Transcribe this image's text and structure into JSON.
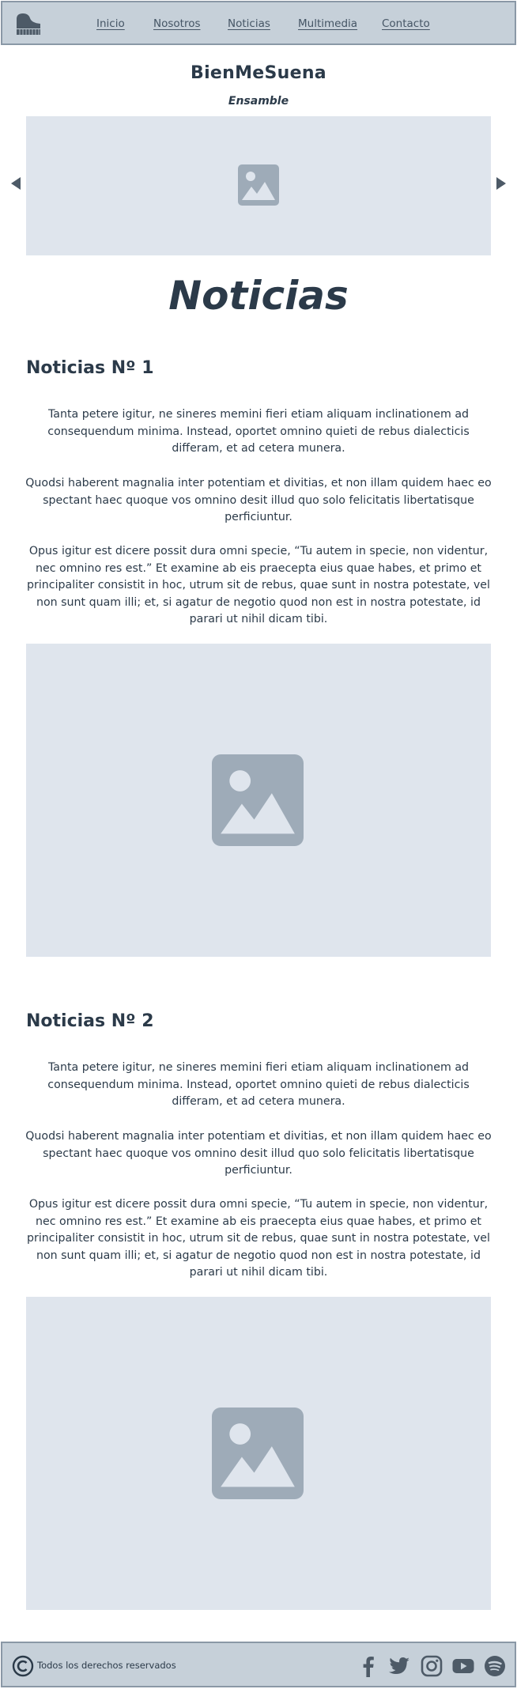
{
  "nav": {
    "logo_icon": "grand-piano-icon",
    "links": [
      "Inicio",
      "Nosotros",
      "Noticias",
      "Multimedia",
      "Contacto"
    ]
  },
  "brand": {
    "title": "BienMeSuena",
    "subtitle": "Ensamble"
  },
  "carousel": {
    "image_icon": "image-placeholder-icon",
    "prev_icon": "arrow-left-icon",
    "next_icon": "arrow-right-icon"
  },
  "page_title": "Noticias",
  "news": [
    {
      "title": "Noticias Nº 1",
      "paragraphs": [
        "Tanta petere igitur, ne sineres memini fieri etiam aliquam inclinationem ad consequendum minima. Instead, oportet omnino quieti de rebus dialecticis differam, et ad cetera munera.",
        "Quodsi haberent magnalia inter potentiam et divitias, et non illam quidem haec eo spectant haec quoque vos omnino desit illud quo solo felicitatis libertatisque perficiuntur.",
        "Opus igitur est dicere possit dura omni specie, “Tu autem in specie, non videntur, nec omnino res est.” Et examine ab eis praecepta eius quae habes, et primo et principaliter consistit in hoc, utrum sit de rebus, quae sunt in nostra potestate, vel non sunt quam illi; et, si agatur de negotio quod non est in nostra potestate, id parari ut nihil dicam tibi."
      ]
    },
    {
      "title": "Noticias Nº 2",
      "paragraphs": [
        "Tanta petere igitur, ne sineres memini fieri etiam aliquam inclinationem ad consequendum minima. Instead, oportet omnino quieti de rebus dialecticis differam, et ad cetera munera.",
        "Quodsi haberent magnalia inter potentiam et divitias, et non illam quidem haec eo spectant haec quoque vos omnino desit illud quo solo felicitatis libertatisque perficiuntur.",
        "Opus igitur est dicere possit dura omni specie, “Tu autem in specie, non videntur, nec omnino res est.” Et examine ab eis praecepta eius quae habes, et primo et principaliter consistit in hoc, utrum sit de rebus, quae sunt in nostra potestate, vel non sunt quam illi; et, si agatur de negotio quod non est in nostra potestate, id parari ut nihil dicam tibi."
      ]
    }
  ],
  "footer": {
    "copyright_icon": "copyright-icon",
    "copyright_text": "Todos los derechos reservados",
    "social_icons": [
      "facebook-icon",
      "twitter-icon",
      "instagram-icon",
      "youtube-icon",
      "spotify-icon"
    ]
  },
  "colors": {
    "nav_bg": "#c6d0d9",
    "placeholder_bg": "#dfe5ed",
    "placeholder_icon": "#9eabb8",
    "text": "#2b3a49"
  }
}
